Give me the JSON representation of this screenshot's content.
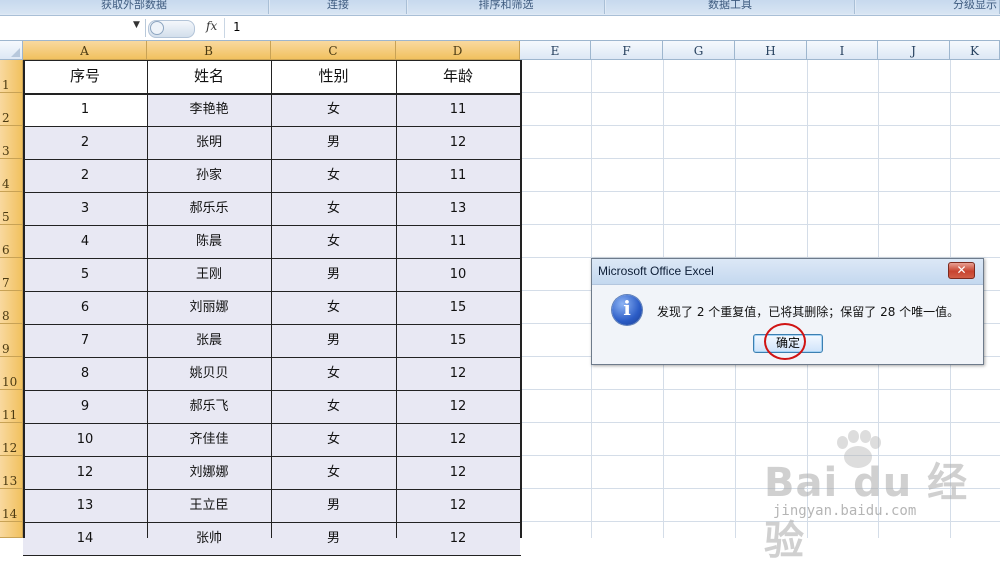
{
  "ribbon": {
    "groups": [
      "获取外部数据",
      "连接",
      "排序和筛选",
      "数据工具",
      "分级显示"
    ]
  },
  "formula_bar": {
    "namebox_value": "",
    "fx_label": "fx",
    "value": "1"
  },
  "columns": [
    "A",
    "B",
    "C",
    "D",
    "E",
    "F",
    "G",
    "H",
    "I",
    "J",
    "K"
  ],
  "rows": [
    "1",
    "2",
    "3",
    "4",
    "5",
    "6",
    "7",
    "8",
    "9",
    "10",
    "11",
    "12",
    "13",
    "14"
  ],
  "table": {
    "headers": [
      "序号",
      "姓名",
      "性别",
      "年龄"
    ],
    "rows": [
      [
        "1",
        "李艳艳",
        "女",
        "11"
      ],
      [
        "2",
        "张明",
        "男",
        "12"
      ],
      [
        "2",
        "孙家",
        "女",
        "11"
      ],
      [
        "3",
        "郝乐乐",
        "女",
        "13"
      ],
      [
        "4",
        "陈晨",
        "女",
        "11"
      ],
      [
        "5",
        "王刚",
        "男",
        "10"
      ],
      [
        "6",
        "刘丽娜",
        "女",
        "15"
      ],
      [
        "7",
        "张晨",
        "男",
        "15"
      ],
      [
        "8",
        "姚贝贝",
        "女",
        "12"
      ],
      [
        "9",
        "郝乐飞",
        "女",
        "12"
      ],
      [
        "10",
        "齐佳佳",
        "女",
        "12"
      ],
      [
        "12",
        "刘娜娜",
        "女",
        "12"
      ],
      [
        "13",
        "王立臣",
        "男",
        "12"
      ],
      [
        "14",
        "张帅",
        "男",
        "12"
      ]
    ]
  },
  "dialog": {
    "title": "Microsoft Office Excel",
    "close_label": "✕",
    "message": "发现了 2 个重复值，已将其删除；保留了 28 个唯一值。",
    "ok_label": "确定"
  },
  "watermark": {
    "logo": "Bai du 经验",
    "url": "jingyan.baidu.com"
  },
  "colors": {
    "selection_header": "#f1c15f",
    "selected_cells": "#e8e8f3",
    "annotation_circle": "#d01414"
  }
}
